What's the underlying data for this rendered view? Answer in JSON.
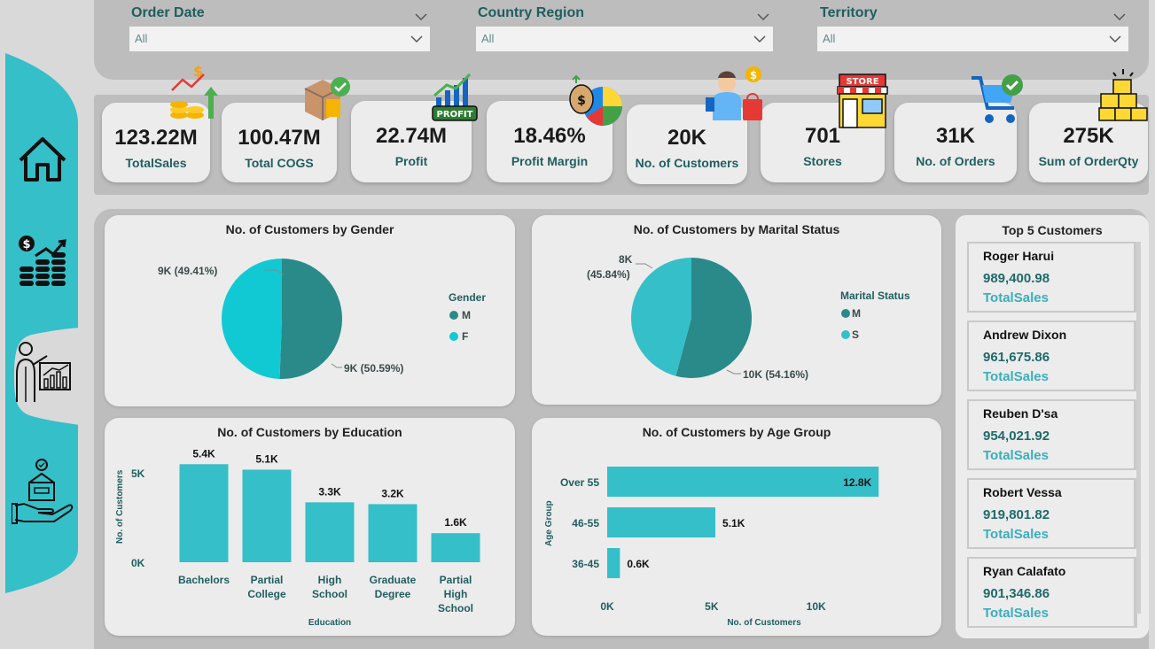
{
  "filters": [
    {
      "title": "Order Date",
      "value": "All"
    },
    {
      "title": "Country Region",
      "value": "All"
    },
    {
      "title": "Territory",
      "value": "All"
    }
  ],
  "nav": [
    "home-icon",
    "sales-growth-icon",
    "presentation-analytics-icon",
    "delivery-hand-box-icon"
  ],
  "kpis": [
    {
      "value": "123.22M",
      "label": "TotalSales",
      "icon": "sales-chart-coins-icon"
    },
    {
      "value": "100.47M",
      "label": "Total COGS",
      "icon": "box-cost-icon"
    },
    {
      "value": "22.74M",
      "label": "Profit",
      "icon": "profit-chart-icon"
    },
    {
      "value": "18.46%",
      "label": "Profit Margin",
      "icon": "money-bag-pie-icon"
    },
    {
      "value": "20K",
      "label": "No. of Customers",
      "icon": "shopper-icon"
    },
    {
      "value": "701",
      "label": "Stores",
      "icon": "store-icon"
    },
    {
      "value": "31K",
      "label": "No. of Orders",
      "icon": "shopping-cart-check-icon"
    },
    {
      "value": "275K",
      "label": "Sum of OrderQty",
      "icon": "stacked-boxes-icon"
    }
  ],
  "gender_chart": {
    "title": "No. of Customers by Gender",
    "legend_title": "Gender",
    "legend": [
      "M",
      "F"
    ],
    "label_f": "9K (49.41%)",
    "label_m": "9K (50.59%)"
  },
  "marital_chart": {
    "title": "No. of Customers by Marital Status",
    "legend_title": "Marital Status",
    "legend": [
      "M",
      "S"
    ],
    "label_s_line1": "8K",
    "label_s_line2": "(45.84%)",
    "label_m": "10K (54.16%)"
  },
  "education_chart": {
    "title": "No. of Customers by Education"
  },
  "age_chart": {
    "title": "No. of Customers by Age Group"
  },
  "chart_data": [
    {
      "type": "pie",
      "title": "No. of Customers by Gender",
      "legend_title": "Gender",
      "slices": [
        {
          "name": "M",
          "value": 9,
          "pct": 50.59,
          "color": "#2a8a8a"
        },
        {
          "name": "F",
          "value": 9,
          "pct": 49.41,
          "color": "#11c9d3"
        }
      ]
    },
    {
      "type": "pie",
      "title": "No. of Customers by Marital Status",
      "legend_title": "Marital Status",
      "slices": [
        {
          "name": "M",
          "value": 10,
          "pct": 54.16,
          "color": "#2a8a8a"
        },
        {
          "name": "S",
          "value": 8,
          "pct": 45.84,
          "color": "#35bfc8"
        }
      ]
    },
    {
      "type": "bar",
      "title": "No. of Customers by Education",
      "categories": [
        "Bachelors",
        "Partial College",
        "High School",
        "Graduate Degree",
        "Partial High School"
      ],
      "values": [
        5.4,
        5.1,
        3.3,
        3.2,
        1.6
      ],
      "value_labels": [
        "5.4K",
        "5.1K",
        "3.3K",
        "3.2K",
        "1.6K"
      ],
      "xlabel": "Education",
      "ylabel": "No. of Customers",
      "yticks": [
        "0K",
        "5K"
      ],
      "ylim": [
        0,
        6
      ],
      "color": "#35bfc8"
    },
    {
      "type": "bar",
      "orientation": "horizontal",
      "title": "No. of Customers by Age Group",
      "categories": [
        "Over 55",
        "46-55",
        "36-45"
      ],
      "values": [
        12.8,
        5.1,
        0.6
      ],
      "value_labels": [
        "12.8K",
        "5.1K",
        "0.6K"
      ],
      "xlabel": "No. of Customers",
      "ylabel": "Age Group",
      "xticks": [
        "0K",
        "5K",
        "10K"
      ],
      "xlim": [
        0,
        13.5
      ],
      "color": "#35bfc8"
    }
  ],
  "top_customers": {
    "title": "Top 5 Customers",
    "items": [
      {
        "name": "Roger Harui",
        "value": "989,400.98",
        "label": "TotalSales"
      },
      {
        "name": "Andrew Dixon",
        "value": "961,675.86",
        "label": "TotalSales"
      },
      {
        "name": "Reuben D'sa",
        "value": "954,021.92",
        "label": "TotalSales"
      },
      {
        "name": "Robert Vessa",
        "value": "919,801.82",
        "label": "TotalSales"
      },
      {
        "name": "Ryan Calafato",
        "value": "901,346.86",
        "label": "TotalSales"
      }
    ]
  }
}
